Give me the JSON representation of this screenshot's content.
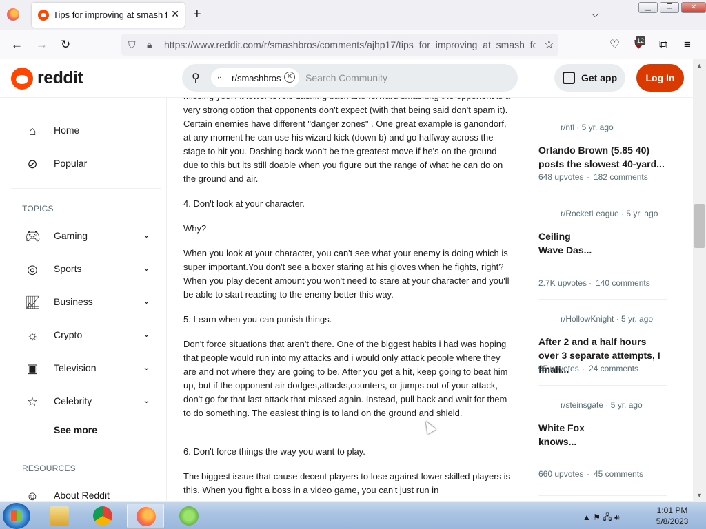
{
  "browser": {
    "tab_title": "Tips for improving at smash for",
    "url": "https://www.reddit.com/r/smashbros/comments/ajhp17/tips_for_improving_at_smash_fo",
    "extension_badge": "12"
  },
  "header": {
    "logo_text": "reddit",
    "search_chip": "r/smashbros",
    "search_placeholder": "Search Community",
    "get_app": "Get app",
    "login": "Log In"
  },
  "leftnav": {
    "home": "Home",
    "popular": "Popular",
    "topics_title": "TOPICS",
    "topics": [
      "Gaming",
      "Sports",
      "Business",
      "Crypto",
      "Television",
      "Celebrity"
    ],
    "see_more": "See more",
    "resources_title": "RESOURCES",
    "about": "About Reddit"
  },
  "post": {
    "paragraphs": [
      "missing you. At lower levels dashing back and forward smashing the opponent is a very strong option that opponents don't expect (with that being said don't spam it). Certain enemies have different \"danger zones\" . One great example is ganondorf, at any moment he can use his wizard kick (down b) and go halfway across the stage to hit you. Dashing back won't be the greatest move if he's on the ground due to this but its still doable when you figure out the range of what he can do on the ground and air.",
      "4. Don't look at your character.",
      "Why?",
      "When you look at your character, you can't see what your enemy is doing which is super important.You don't see a boxer staring at his gloves when he fights, right? When you play decent amount you won't need to stare at your character and you'll be able to start reacting to the enemy better this way.",
      "5. Learn when you can punish things.",
      "Don't force situations that aren't there. One of the biggest habits i had was hoping that people would run into my attacks and i would only attack people where they are and not where they are going to be. After you get a hit, keep going to beat him up, but if the opponent air dodges,attacks,counters, or jumps out of your attack, don't go for that last attack that missed again. Instead, pull back and wait for them to do something. The easiest thing is to land on the ground and shield.",
      "6. Don't force things the way you want to play.",
      "The biggest issue that cause decent players to lose against lower skilled players is this. When you fight a boss in a video game, you can't just run in"
    ]
  },
  "rail": [
    {
      "sub": "r/nfl · 5 yr. ago",
      "title": "Orlando Brown (5.85 40) posts the slowest 40-yard...",
      "upvotes": "648 upvotes",
      "comments": "182 comments"
    },
    {
      "sub": "r/RocketLeague · 5 yr. ago",
      "title": "Ceiling Wave Das...",
      "upvotes": "2.7K upvotes",
      "comments": "140 comments"
    },
    {
      "sub": "r/HollowKnight · 5 yr. ago",
      "title": "After 2 and a half hours over 3 separate attempts, I finall...",
      "upvotes": "95 upvotes",
      "comments": "24 comments"
    },
    {
      "sub": "r/steinsgate · 5 yr. ago",
      "title": "White Fox knows...",
      "upvotes": "660 upvotes",
      "comments": "45 comments"
    }
  ],
  "taskbar": {
    "time": "1:01 PM",
    "date": "5/8/2023"
  },
  "colors": {
    "reddit_orange": "#ff4500",
    "login_button": "#d93a00"
  }
}
